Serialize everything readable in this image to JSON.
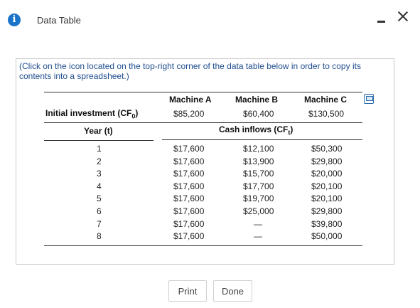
{
  "window": {
    "title": "Data Table"
  },
  "instruction": "(Click on the icon located on the top-right corner of the data table below in order to copy its contents into a spreadsheet.)",
  "table": {
    "columns": [
      "Machine A",
      "Machine B",
      "Machine C"
    ],
    "initial_label": "Initial investment (CF",
    "initial_sub": "0",
    "initial_close": ")",
    "initial_values": [
      "$85,200",
      "$60,400",
      "$130,500"
    ],
    "year_label": "Year (t)",
    "cash_label": "Cash inflows (CF",
    "cash_sub": "t",
    "cash_close": ")",
    "rows": [
      {
        "year": "1",
        "a": "$17,600",
        "b": "$12,100",
        "c": "$50,300"
      },
      {
        "year": "2",
        "a": "$17,600",
        "b": "$13,900",
        "c": "$29,800"
      },
      {
        "year": "3",
        "a": "$17,600",
        "b": "$15,700",
        "c": "$20,000"
      },
      {
        "year": "4",
        "a": "$17,600",
        "b": "$17,700",
        "c": "$20,100"
      },
      {
        "year": "5",
        "a": "$17,600",
        "b": "$19,700",
        "c": "$20,100"
      },
      {
        "year": "6",
        "a": "$17,600",
        "b": "$25,000",
        "c": "$29,800"
      },
      {
        "year": "7",
        "a": "$17,600",
        "b": "—",
        "c": "$39,800"
      },
      {
        "year": "8",
        "a": "$17,600",
        "b": "—",
        "c": "$50,000"
      }
    ]
  },
  "buttons": {
    "print": "Print",
    "done": "Done"
  }
}
